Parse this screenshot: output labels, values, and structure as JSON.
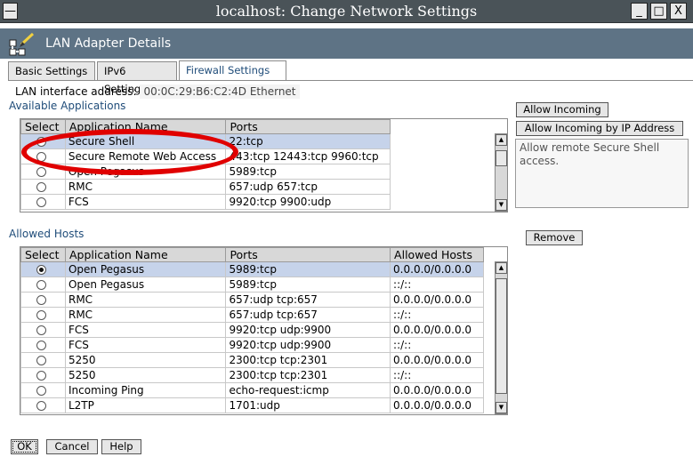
{
  "window": {
    "title": "localhost: Change Network Settings",
    "minimize": "_",
    "maximize": "□",
    "close": "X",
    "menu": "—"
  },
  "header": {
    "title": "LAN Adapter Details",
    "icon": "network-adapter-icon"
  },
  "tabs": [
    {
      "label": "Basic Settings",
      "active": false
    },
    {
      "label": "IPv6 Settings",
      "active": false
    },
    {
      "label": "Firewall Settings",
      "active": true
    }
  ],
  "lan": {
    "label": "LAN interface address:",
    "value": "00:0C:29:B6:C2:4D Ethernet"
  },
  "available": {
    "title": "Available Applications",
    "headers": [
      "Select",
      "Application Name",
      "Ports"
    ],
    "rows": [
      {
        "selected": false,
        "highlight": true,
        "name": "Secure Shell",
        "ports": "22:tcp"
      },
      {
        "selected": false,
        "highlight": false,
        "name": "Secure Remote Web Access",
        "ports": "443:tcp 12443:tcp 9960:tcp"
      },
      {
        "selected": false,
        "highlight": false,
        "name": "Open Pegasus",
        "ports": "5989:tcp"
      },
      {
        "selected": false,
        "highlight": false,
        "name": "RMC",
        "ports": "657:udp 657:tcp"
      },
      {
        "selected": false,
        "highlight": false,
        "name": "FCS",
        "ports": "9920:tcp 9900:udp"
      }
    ]
  },
  "buttons": {
    "allow_incoming": "Allow Incoming",
    "allow_by_ip": "Allow Incoming by IP Address",
    "remove": "Remove",
    "ok": "OK",
    "cancel": "Cancel",
    "help": "Help"
  },
  "description": "Allow remote Secure Shell access.",
  "allowed": {
    "title": "Allowed Hosts",
    "headers": [
      "Select",
      "Application Name",
      "Ports",
      "Allowed Hosts"
    ],
    "rows": [
      {
        "selected": true,
        "name": "Open Pegasus",
        "ports": "5989:tcp",
        "hosts": "0.0.0.0/0.0.0.0"
      },
      {
        "selected": false,
        "name": "Open Pegasus",
        "ports": "5989:tcp",
        "hosts": "::/::"
      },
      {
        "selected": false,
        "name": "RMC",
        "ports": "657:udp tcp:657",
        "hosts": "0.0.0.0/0.0.0.0"
      },
      {
        "selected": false,
        "name": "RMC",
        "ports": "657:udp tcp:657",
        "hosts": "::/::"
      },
      {
        "selected": false,
        "name": "FCS",
        "ports": "9920:tcp udp:9900",
        "hosts": "0.0.0.0/0.0.0.0"
      },
      {
        "selected": false,
        "name": "FCS",
        "ports": "9920:tcp udp:9900",
        "hosts": "::/::"
      },
      {
        "selected": false,
        "name": "5250",
        "ports": "2300:tcp tcp:2301",
        "hosts": "0.0.0.0/0.0.0.0"
      },
      {
        "selected": false,
        "name": "5250",
        "ports": "2300:tcp tcp:2301",
        "hosts": "::/::"
      },
      {
        "selected": false,
        "name": "Incoming Ping",
        "ports": "echo-request:icmp",
        "hosts": "0.0.0.0/0.0.0.0"
      },
      {
        "selected": false,
        "name": "L2TP",
        "ports": "1701:udp",
        "hosts": "0.0.0.0/0.0.0.0"
      }
    ]
  },
  "colors": {
    "header": "#5e7385",
    "titlebar": "#4a5358",
    "accent_text": "#1f4c79",
    "annotation": "#e00000",
    "selection": "#c6d3ea"
  }
}
